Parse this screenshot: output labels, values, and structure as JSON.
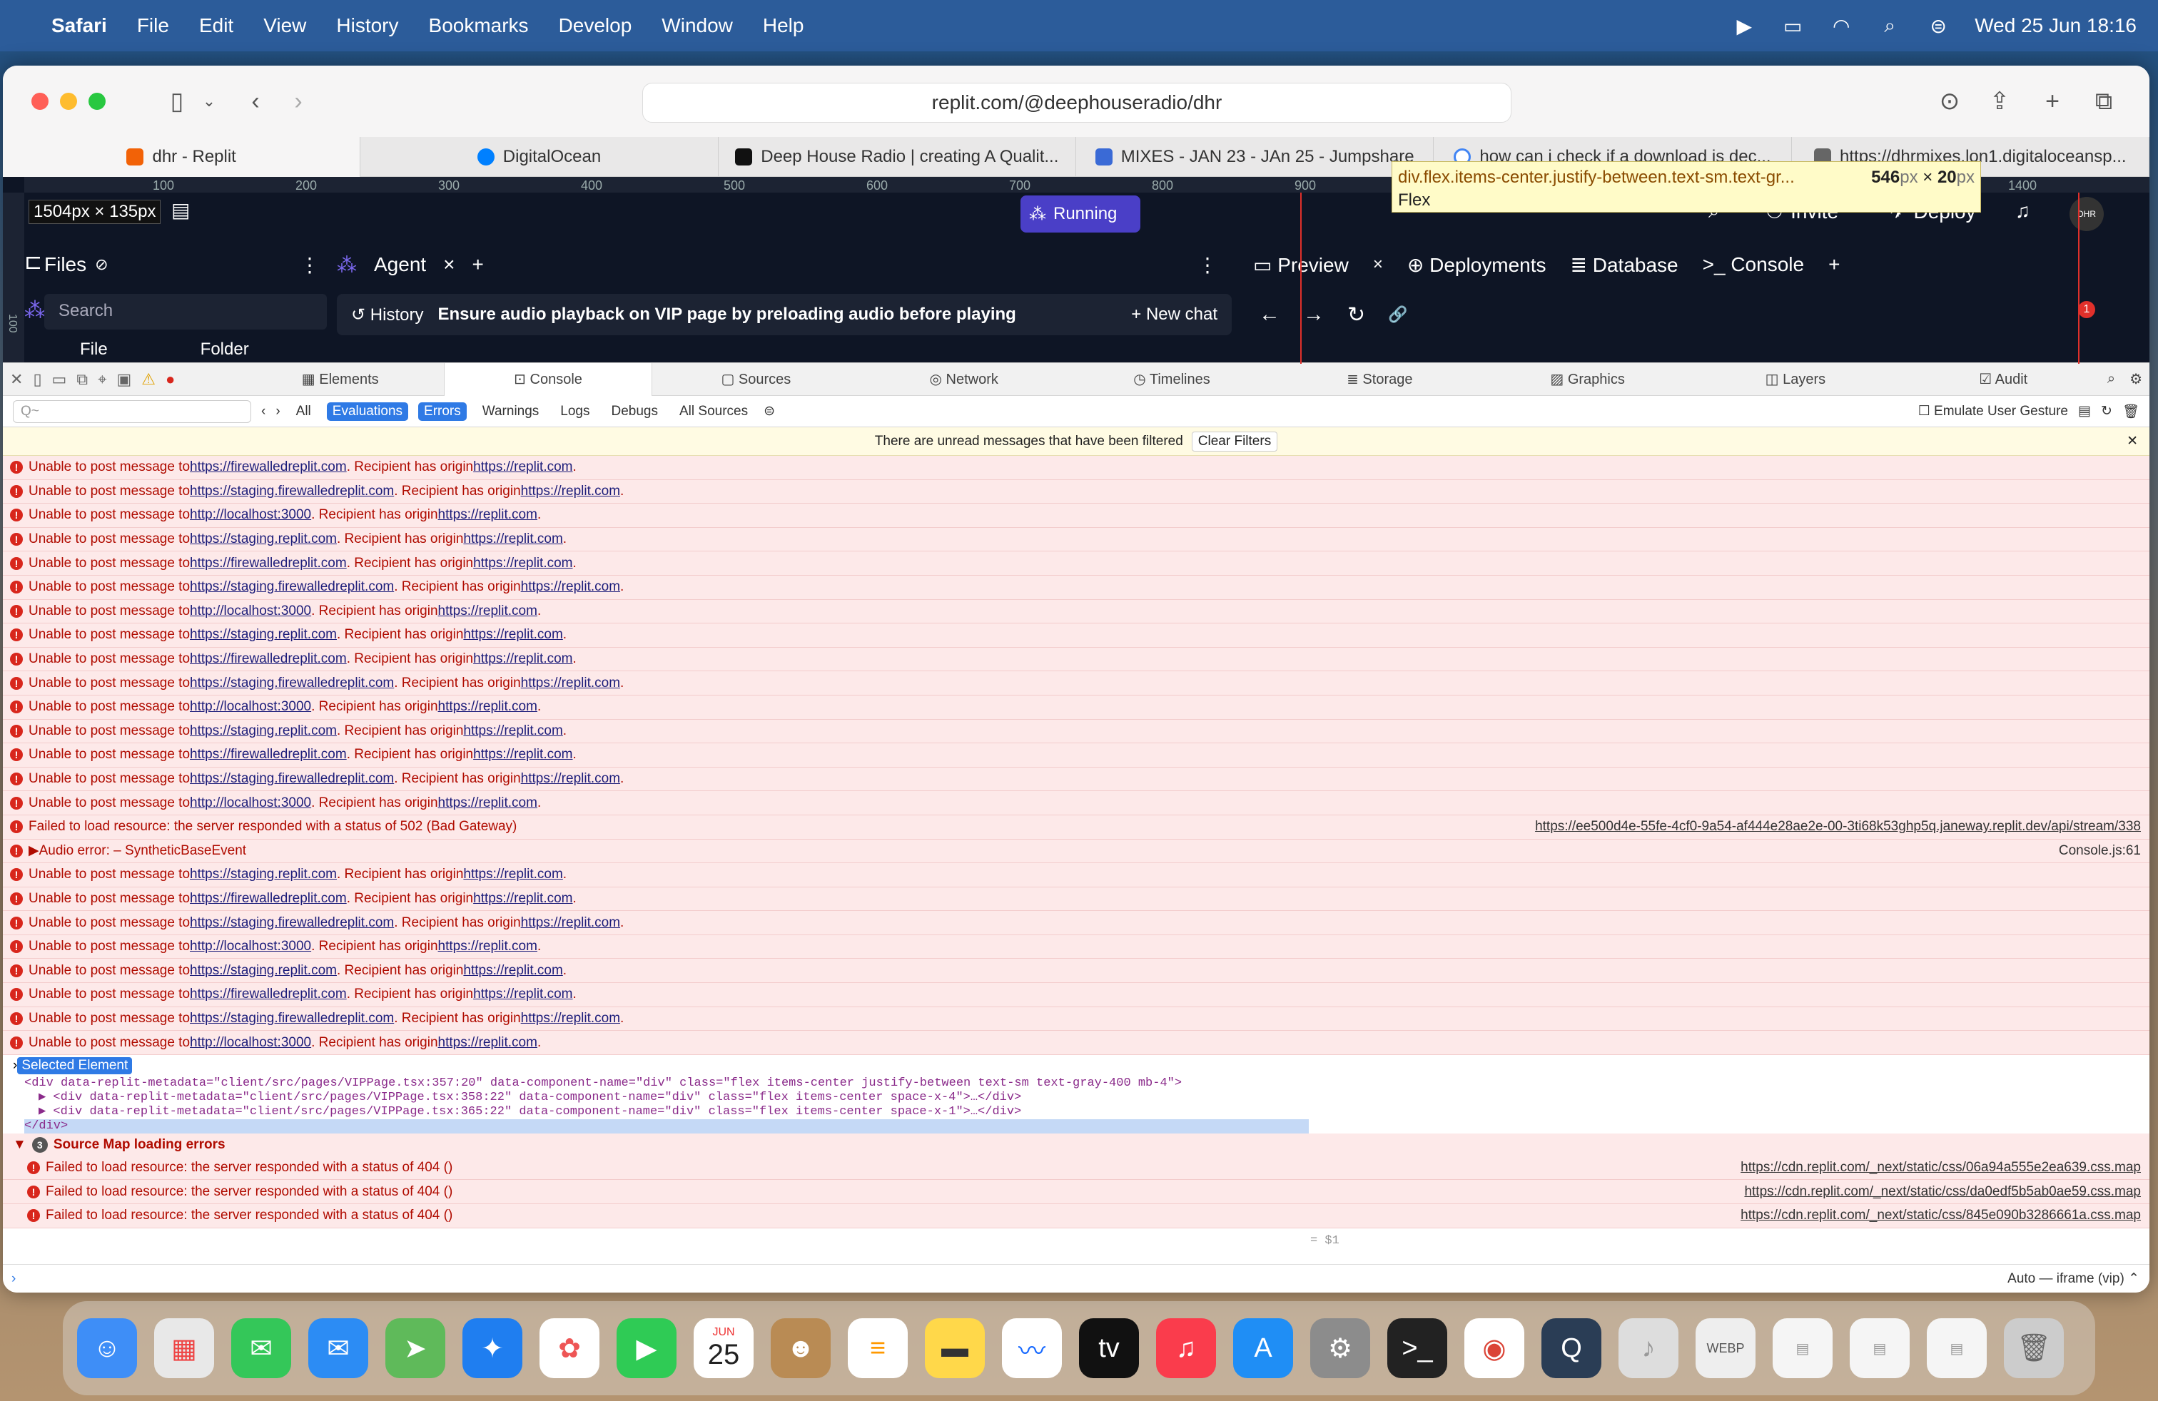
{
  "menubar": {
    "app": "Safari",
    "items": [
      "File",
      "Edit",
      "View",
      "History",
      "Bookmarks",
      "Develop",
      "Window",
      "Help"
    ],
    "clock": "Wed 25 Jun  18:16"
  },
  "browser": {
    "address": "replit.com/@deephouseradio/dhr",
    "tabs": [
      "dhr - Replit",
      "DigitalOcean",
      "Deep House Radio | creating A Qualit...",
      "MIXES - JAN 23 - JAn 25 - Jumpshare",
      "how can i check if a download is dec...",
      "https://dhrmixes.lon1.digitaloceansp..."
    ]
  },
  "replit": {
    "dims": "1504px × 135px",
    "running": "Running",
    "invite": "Invite",
    "deploy": "Deploy",
    "avatar": "DHR",
    "badge": "1",
    "files": {
      "title": "Files",
      "search": "Search",
      "file": "File",
      "folder": "Folder"
    },
    "agent": {
      "tab": "Agent",
      "history": "History",
      "task": "Ensure audio playback on VIP page by preloading audio before playing",
      "new_chat": "New chat"
    },
    "preview_tabs": [
      "Preview",
      "Deployments",
      "Database",
      "Console"
    ],
    "ruler": [
      "100",
      "200",
      "300",
      "400",
      "500",
      "600",
      "700",
      "800",
      "900",
      "1000",
      "1100",
      "1200",
      "1300",
      "1400"
    ],
    "vruler": "100"
  },
  "tooltip": {
    "selector": "div.flex.items-center.justify-between.text-sm.text-gr...",
    "w": "546",
    "h": "20",
    "unit": "px",
    "x": "×",
    "type": "Flex"
  },
  "devtools": {
    "tabs": [
      "Elements",
      "Console",
      "Sources",
      "Network",
      "Timelines",
      "Storage",
      "Graphics",
      "Layers",
      "Audit"
    ],
    "filters": [
      "All",
      "Evaluations",
      "Errors",
      "Warnings",
      "Logs",
      "Debugs",
      "All Sources"
    ],
    "filter_placeholder": "Q~",
    "emulate": "Emulate User Gesture",
    "notice": "There are unread messages that have been filtered",
    "clear": "Clear Filters",
    "pm_prefix": "Unable to post message to ",
    "pm_mid": ". Recipient has origin ",
    "pm_end": ".",
    "origin": "https://replit.com",
    "targets": {
      "a": "https://firewalledreplit.com",
      "b": "https://staging.firewalledreplit.com",
      "c": "http://localhost:3000",
      "d": "https://staging.replit.com"
    },
    "failed": "Failed to load resource: the server responded with a status of 502 (Bad Gateway)",
    "failed_src": "https://ee500d4e-55fe-4cf0-9a54-af444e28ae2e-00-3ti68k53ghp5q.janeway.replit.dev/api/stream/338",
    "audio": "Audio error: – SyntheticBaseEvent",
    "audio_src": "Console.js:61",
    "selected": "Selected Element",
    "code": [
      "<div data-replit-metadata=\"client/src/pages/VIPPage.tsx:357:20\" data-component-name=\"div\" class=\"flex items-center justify-between text-sm text-gray-400 mb-4\">",
      "▶ <div data-replit-metadata=\"client/src/pages/VIPPage.tsx:358:22\" data-component-name=\"div\" class=\"flex items-center space-x-4\">…</div>",
      "▶ <div data-replit-metadata=\"client/src/pages/VIPPage.tsx:365:22\" data-component-name=\"div\" class=\"flex items-center space-x-1\">…</div>",
      "</div>"
    ],
    "code_eq": "= $1",
    "group": "Source Map loading errors",
    "group_count": "3",
    "map_err": "Failed to load resource: the server responded with a status of 404 ()",
    "maps": [
      "https://cdn.replit.com/_next/static/css/06a94a555e2ea639.css.map",
      "https://cdn.replit.com/_next/static/css/da0edf5b5ab0ae59.css.map",
      "https://cdn.replit.com/_next/static/css/845e090b3286661a.css.map"
    ],
    "context": "Auto — iframe (vip) ⌃"
  },
  "dock": {
    "date_month": "JUN",
    "date_day": "25"
  }
}
